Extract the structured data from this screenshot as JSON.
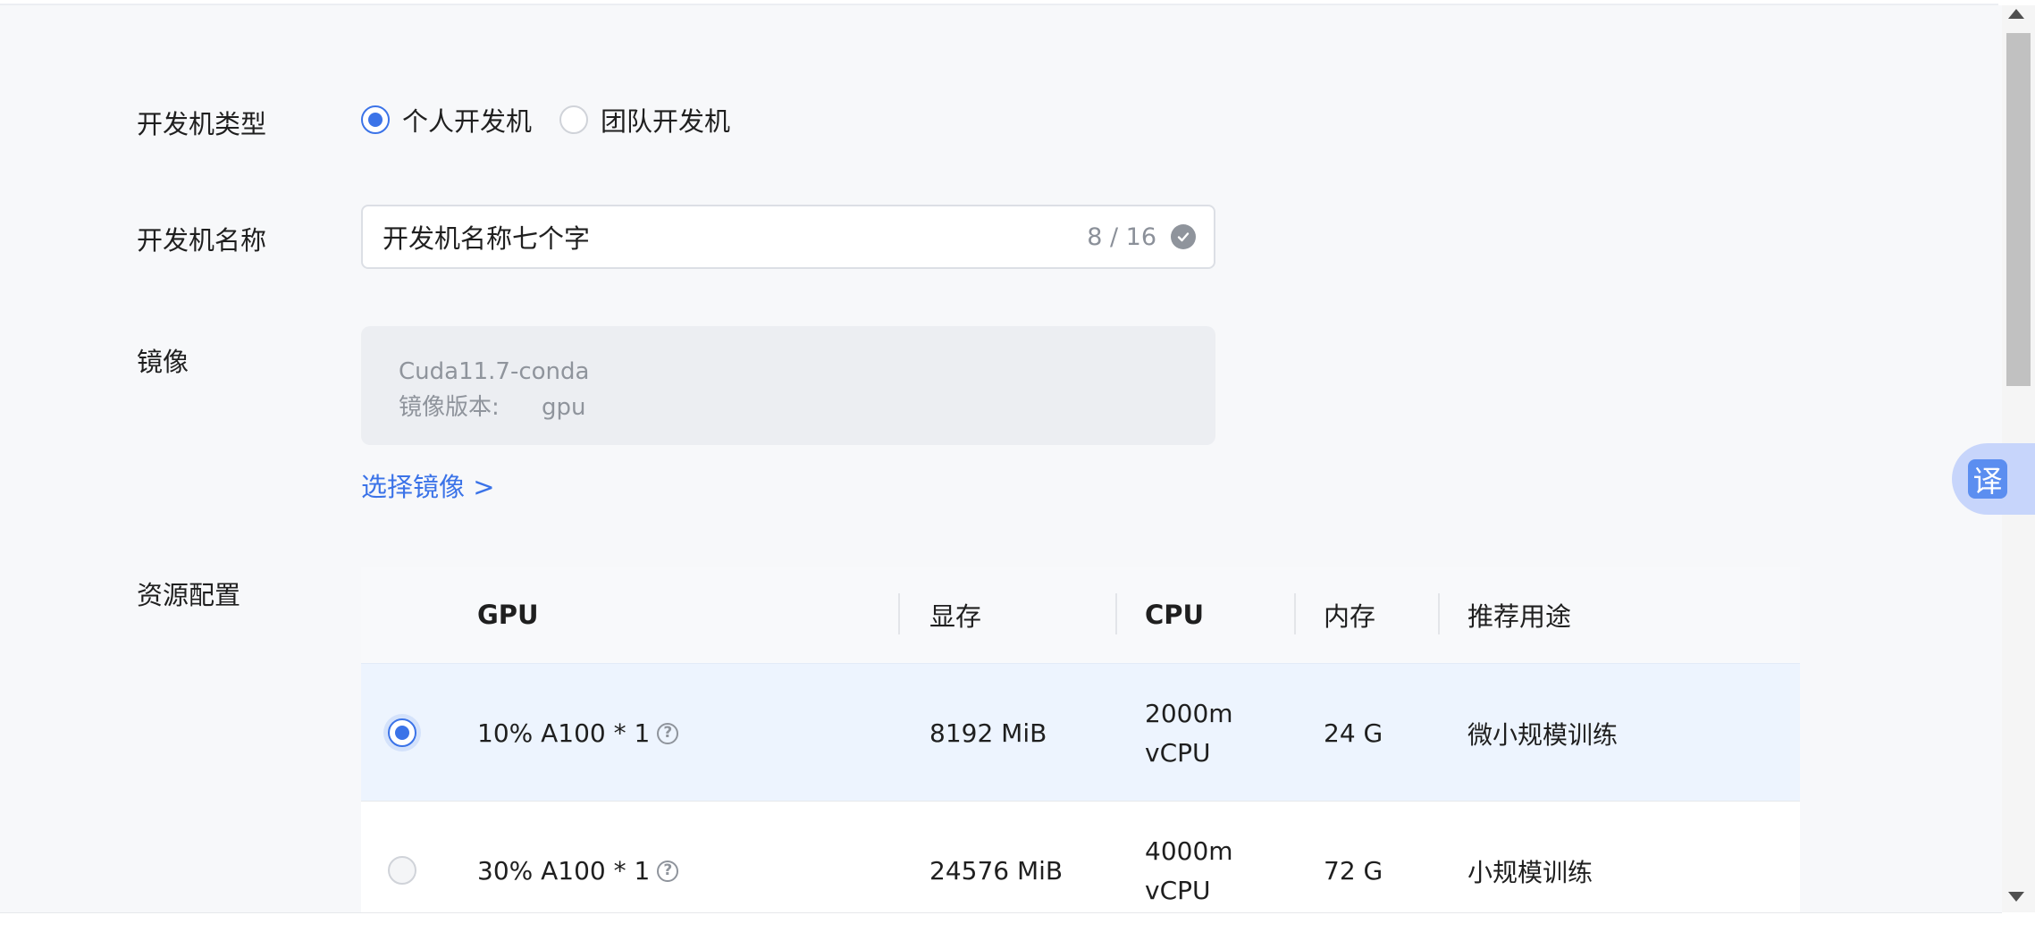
{
  "form": {
    "type_label": "开发机类型",
    "type_options": [
      {
        "label": "个人开发机",
        "checked": true
      },
      {
        "label": "团队开发机",
        "checked": false
      }
    ],
    "name_label": "开发机名称",
    "name_value": "开发机名称七个字",
    "name_count": "8 / 16",
    "image_label": "镜像",
    "image_name": "Cuda11.7-conda",
    "image_version_label": "镜像版本:",
    "image_version_value": "gpu",
    "select_image_link": "选择镜像 >",
    "resource_label": "资源配置"
  },
  "table": {
    "headers": {
      "gpu": "GPU",
      "vram": "显存",
      "cpu": "CPU",
      "memory": "内存",
      "usage": "推荐用途"
    },
    "rows": [
      {
        "selected": true,
        "gpu": "10% A100 * 1",
        "vram": "8192 MiB",
        "cpu_line1": "2000m",
        "cpu_line2": "vCPU",
        "memory": "24 G",
        "usage": "微小规模训练"
      },
      {
        "selected": false,
        "gpu": "30% A100 * 1",
        "vram": "24576 MiB",
        "cpu_line1": "4000m",
        "cpu_line2": "vCPU",
        "memory": "72 G",
        "usage": "小规模训练"
      }
    ]
  },
  "help_glyph": "?",
  "translate": {
    "glyph": "译"
  },
  "colors": {
    "accent": "#3b73e8",
    "background": "#f7f8fa",
    "selected_row": "#edf4fe"
  }
}
